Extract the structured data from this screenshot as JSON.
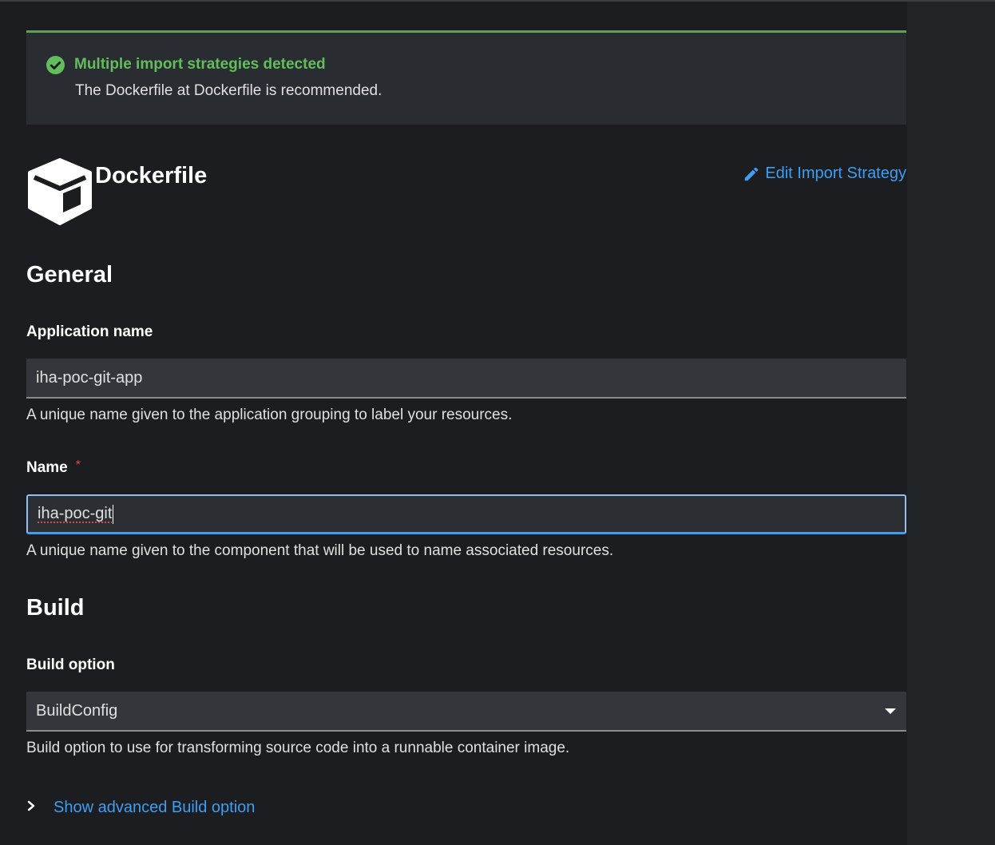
{
  "alert": {
    "title": "Multiple import strategies detected",
    "message": "The Dockerfile at Dockerfile is recommended.",
    "icon": "check-circle-icon",
    "color": "#63bd5c"
  },
  "strategy": {
    "name": "Dockerfile",
    "icon": "cube-icon",
    "edit_label": "Edit Import Strategy"
  },
  "general": {
    "heading": "General",
    "application_name": {
      "label": "Application name",
      "value": "iha-poc-git-app",
      "helper": "A unique name given to the application grouping to label your resources."
    },
    "name": {
      "label": "Name",
      "required_mark": "*",
      "value": "iha-poc-git",
      "helper": "A unique name given to the component that will be used to name associated resources."
    }
  },
  "build": {
    "heading": "Build",
    "build_option": {
      "label": "Build option",
      "selected": "BuildConfig",
      "helper": "Build option to use for transforming source code into a runnable container image."
    },
    "advanced_label": "Show advanced Build option"
  },
  "colors": {
    "background": "#1b1d21",
    "link": "#3d9ef2",
    "success": "#63bd5c",
    "required": "#e0483f"
  }
}
